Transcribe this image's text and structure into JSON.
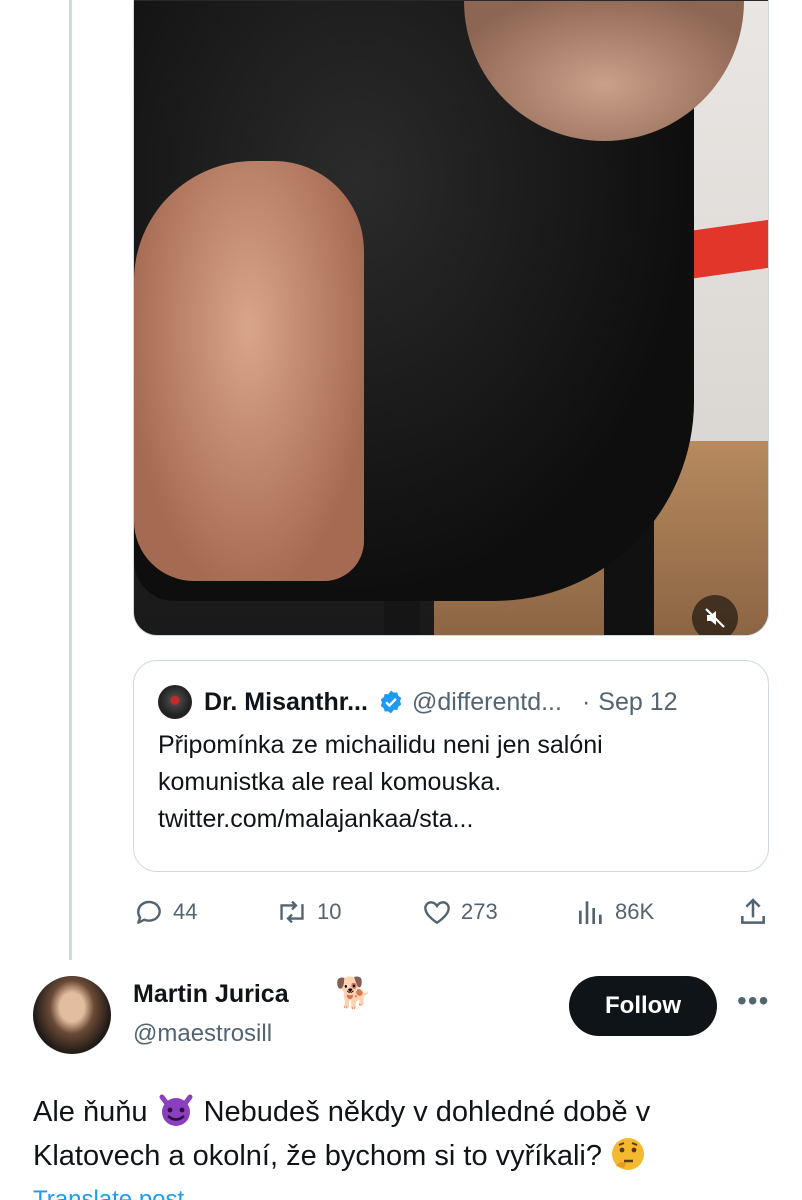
{
  "quoted_tweet": {
    "name": "Dr. Misanthr...",
    "handle": "@differentd...",
    "separator": "·",
    "date": "Sep 12",
    "text_lines": [
      "Připomínka ze michailidu neni jen salóni",
      "komunistka ale real komouska.",
      "twitter.com/malajankaa/sta..."
    ]
  },
  "actions": {
    "replies": "44",
    "retweets": "10",
    "likes": "273",
    "views": "86K"
  },
  "reply_author": {
    "name": "Martin Jurica",
    "name_emoji": "🐕",
    "handle": "@maestrosill",
    "follow_label": "Follow",
    "more_label": "•••"
  },
  "reply": {
    "text_part1": "Ale ňuňu ",
    "text_part2": " Nebudeš někdy v dohledné době v",
    "text_line2": "Klatovech a okolní, že bychom si to vyříkali? ",
    "translate_label": "Translate post"
  },
  "colors": {
    "link": "#1d9bf0",
    "verified": "#1d9bf0",
    "text": "#0f1419",
    "muted": "#536471",
    "border": "#cfd9de"
  }
}
